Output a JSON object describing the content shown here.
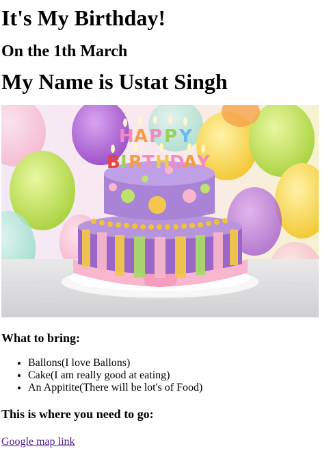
{
  "header": {
    "title": "It's My Birthday!",
    "date": "On the 1th March",
    "name": "My Name is Ustat Singh"
  },
  "hero_image": {
    "cake_lettering_top": "HAPPY",
    "cake_lettering_bottom": "BIRTHDAY"
  },
  "bring": {
    "heading": "What to bring:",
    "items": [
      "Ballons(I love Ballons)",
      "Cake(I am really good at eating)",
      "An Appitite(There will be lot's of Food)"
    ]
  },
  "location": {
    "heading": "This is where you need to go:",
    "link_label": "Google map link"
  },
  "colors": {
    "link_visited": "#551a8b"
  }
}
